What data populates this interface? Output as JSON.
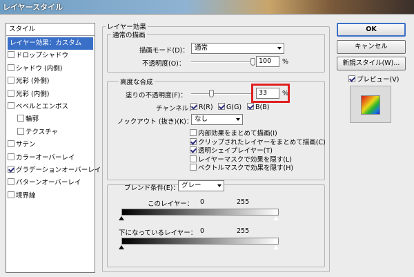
{
  "window": {
    "title": "レイヤースタイル"
  },
  "style_list": {
    "header": "スタイル",
    "items": [
      {
        "label": "レイヤー効果：カスタム",
        "checkbox": false,
        "checked": false,
        "selected": true,
        "indent": false
      },
      {
        "label": "ドロップシャドウ",
        "checkbox": true,
        "checked": false,
        "selected": false,
        "indent": false
      },
      {
        "label": "シャドウ (内側)",
        "checkbox": true,
        "checked": false,
        "selected": false,
        "indent": false
      },
      {
        "label": "光彩 (外側)",
        "checkbox": true,
        "checked": false,
        "selected": false,
        "indent": false
      },
      {
        "label": "光彩 (内側)",
        "checkbox": true,
        "checked": false,
        "selected": false,
        "indent": false
      },
      {
        "label": "ベベルとエンボス",
        "checkbox": true,
        "checked": false,
        "selected": false,
        "indent": false
      },
      {
        "label": "輪郭",
        "checkbox": true,
        "checked": false,
        "selected": false,
        "indent": true
      },
      {
        "label": "テクスチャ",
        "checkbox": true,
        "checked": false,
        "selected": false,
        "indent": true
      },
      {
        "label": "サテン",
        "checkbox": true,
        "checked": false,
        "selected": false,
        "indent": false
      },
      {
        "label": "カラーオーバーレイ",
        "checkbox": true,
        "checked": false,
        "selected": false,
        "indent": false
      },
      {
        "label": "グラデーションオーバーレイ",
        "checkbox": true,
        "checked": true,
        "selected": false,
        "indent": false
      },
      {
        "label": "パターンオーバーレイ",
        "checkbox": true,
        "checked": false,
        "selected": false,
        "indent": false
      },
      {
        "label": "境界線",
        "checkbox": true,
        "checked": false,
        "selected": false,
        "indent": false
      }
    ]
  },
  "layer_effects": {
    "group_title": "レイヤー効果",
    "normal_blend": {
      "title": "通常の描画",
      "blend_mode_label": "描画モード(D)：",
      "blend_mode_value": "通常",
      "opacity_label": "不透明度(O)：",
      "opacity_value": "100",
      "opacity_unit": "%",
      "opacity_level": 1.0
    },
    "advanced": {
      "title": "高度な合成",
      "fill_opacity_label": "塗りの不透明度(F)：",
      "fill_opacity_value": "33",
      "fill_opacity_unit": "%",
      "fill_opacity_level": 0.33,
      "channels_label": "チャンネル：",
      "channels": [
        {
          "label": "R(R)",
          "checked": true
        },
        {
          "label": "G(G)",
          "checked": true
        },
        {
          "label": "B(B)",
          "checked": true
        }
      ],
      "knockout_label": "ノックアウト (抜き)(K)：",
      "knockout_value": "なし",
      "options": [
        {
          "label": "内部効果をまとめて描画(I)",
          "checked": false
        },
        {
          "label": "クリップされたレイヤーをまとめて描画(C)",
          "checked": true
        },
        {
          "label": "透明シェイプレイヤー(T)",
          "checked": true
        },
        {
          "label": "レイヤーマスクで効果を隠す(L)",
          "checked": false
        },
        {
          "label": "ベクトルマスクで効果を隠す(H)",
          "checked": false
        }
      ]
    },
    "blend_if": {
      "label": "ブレンド条件(E)：",
      "value": "グレー",
      "this_layer_label": "このレイヤー：",
      "this_layer_min": "0",
      "this_layer_max": "255",
      "underlying_label": "下になっているレイヤー：",
      "underlying_min": "0",
      "underlying_max": "255"
    }
  },
  "buttons": {
    "ok": "OK",
    "cancel": "キャンセル",
    "new_style": "新規スタイル(W)...",
    "preview_label": "プレビュー(V)",
    "preview_checked": true
  },
  "colors": {
    "selection": "#3a6fc7",
    "highlight_box": "#e02020",
    "dialog_bg": "#ececec"
  }
}
